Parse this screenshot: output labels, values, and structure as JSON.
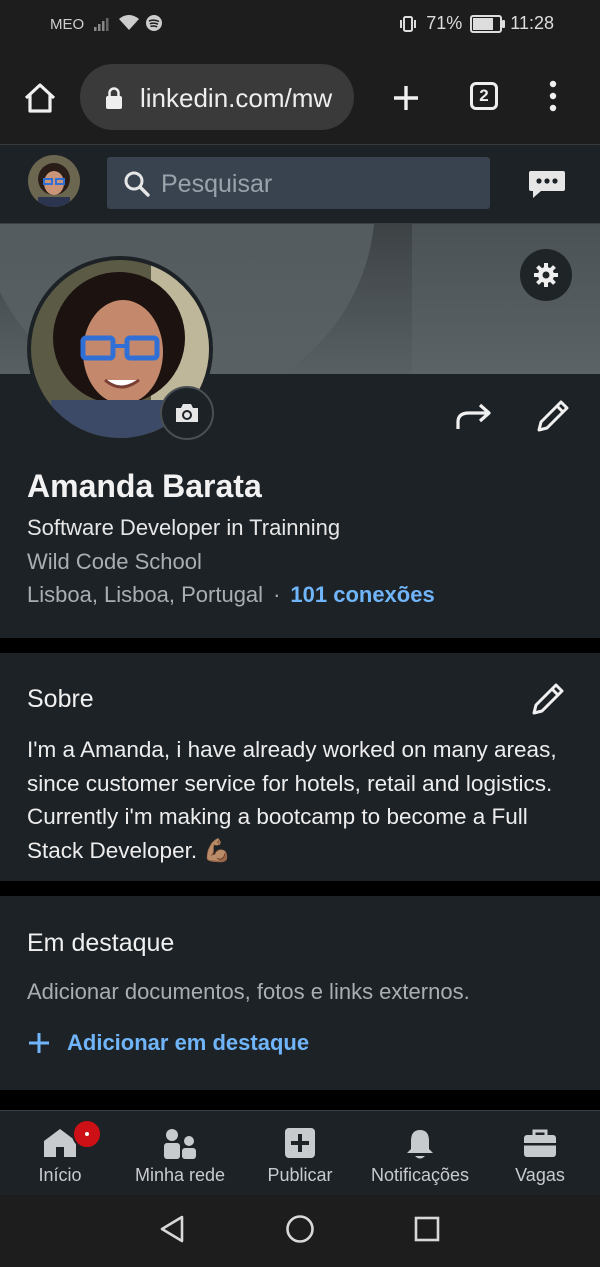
{
  "status_bar": {
    "carrier": "MEO",
    "battery": "71%",
    "time": "11:28"
  },
  "browser": {
    "url": "linkedin.com/mw",
    "tab_count": "2"
  },
  "linkedin_nav": {
    "search_placeholder": "Pesquisar"
  },
  "profile": {
    "name": "Amanda Barata",
    "headline": "Software Developer in Trainning",
    "company": "Wild Code School",
    "location": "Lisboa, Lisboa, Portugal",
    "separator": "·",
    "connections": "101 conexões"
  },
  "about": {
    "title": "Sobre",
    "text": "I'm a Amanda, i have already worked on many areas, since customer service for hotels, retail and logistics. Currently i'm making a bootcamp to become a Full Stack Developer. 💪🏽"
  },
  "featured": {
    "title": "Em destaque",
    "description": "Adicionar documentos, fotos e links externos.",
    "add_label": "Adicionar em destaque"
  },
  "bottom_nav": [
    {
      "label": "Início",
      "icon": "home-icon"
    },
    {
      "label": "Minha rede",
      "icon": "network-icon"
    },
    {
      "label": "Publicar",
      "icon": "post-icon"
    },
    {
      "label": "Notificações",
      "icon": "bell-icon"
    },
    {
      "label": "Vagas",
      "icon": "briefcase-icon"
    }
  ],
  "colors": {
    "link": "#70b5f9",
    "card_bg": "#1d2226",
    "badge": "#cc1016"
  }
}
